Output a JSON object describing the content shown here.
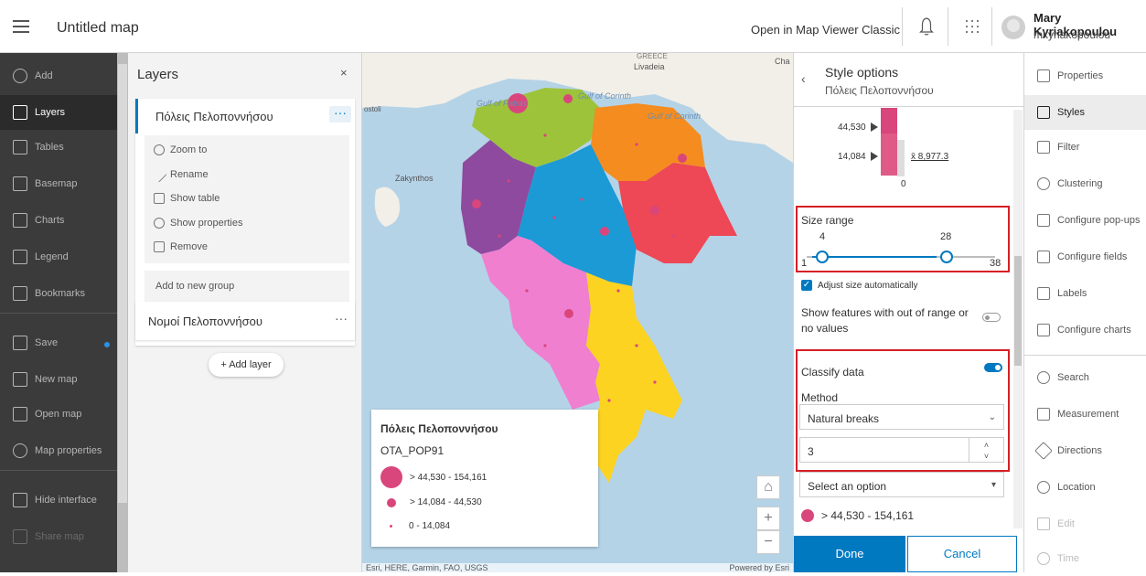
{
  "header": {
    "map_title": "Untitled map",
    "open_classic": "Open in Map Viewer Classic",
    "user_name": "Mary Kyriakopoulou",
    "user_login": "mkyriakopoulou"
  },
  "left_nav": {
    "items": [
      {
        "label": "Add",
        "icon": "plus-circle-icon"
      },
      {
        "label": "Layers",
        "icon": "layers-icon",
        "active": true
      },
      {
        "label": "Tables",
        "icon": "table-icon"
      },
      {
        "label": "Basemap",
        "icon": "basemap-icon"
      },
      {
        "label": "Charts",
        "icon": "chart-icon"
      },
      {
        "label": "Legend",
        "icon": "legend-icon"
      },
      {
        "label": "Bookmarks",
        "icon": "bookmark-icon"
      },
      {
        "label": "Save",
        "icon": "save-icon"
      },
      {
        "label": "New map",
        "icon": "new-map-icon"
      },
      {
        "label": "Open map",
        "icon": "folder-icon"
      },
      {
        "label": "Map properties",
        "icon": "gear-icon"
      },
      {
        "label": "Hide interface",
        "icon": "monitor-icon"
      },
      {
        "label": "Share map",
        "icon": "share-icon",
        "disabled": true
      }
    ]
  },
  "layers_panel": {
    "title": "Layers",
    "close": "×",
    "layer1": {
      "name": "Πόλεις Πελοποννήσου",
      "more": "···",
      "actions": [
        "Zoom to",
        "Rename",
        "Show table",
        "Show properties",
        "Remove"
      ],
      "add_group": "Add to new group"
    },
    "layer2": {
      "name": "Νομοί Πελοποννήσου",
      "more": "···"
    },
    "add_layer": "+  Add layer"
  },
  "map": {
    "labels": {
      "greece": "GREECE",
      "livadeia": "Livadeia",
      "gulf_patras": "Gulf of Patras",
      "gulf_corinth1": "Gulf of Corinth",
      "gulf_corinth2": "Gulf of Corinth",
      "zakynthos": "Zakynthos",
      "ostoli": "ostoli",
      "chalkida": "Cha"
    },
    "legend": {
      "title": "Πόλεις Πελοποννήσου",
      "field": "OTA_POP91",
      "rows": [
        {
          "label": "> 44,530 - 154,161"
        },
        {
          "label": "> 14,084 - 44,530"
        },
        {
          "label": "0 - 14,084"
        }
      ]
    },
    "attribution_left": "Esri, HERE, Garmin, FAO, USGS",
    "attribution_right": "Powered by Esri",
    "colors": {
      "water": "#b5d3e7",
      "land": "#f2efe8",
      "symbol": "#d9467b",
      "regions": [
        "#9dc33b",
        "#f58c1f",
        "#8e4a9e",
        "#1b9ad6",
        "#ee4755",
        "#f07fd0",
        "#fcd320"
      ]
    }
  },
  "style_panel": {
    "title": "Style options",
    "subtitle": "Πόλεις Πελοποννήσου",
    "histogram": {
      "label_top": "44,530",
      "label_mid": "14,084",
      "mean": "x̄ 8,977.3",
      "label_zero": "0"
    },
    "size_range": {
      "label": "Size range",
      "min_value": "4",
      "max_value": "28",
      "range_min": "1",
      "range_max": "38",
      "min_fraction": 0.08,
      "max_fraction": 0.7
    },
    "adjust_auto": "Adjust size automatically",
    "show_out_of_range": "Show features with out of range or no values",
    "classify": {
      "label": "Classify data",
      "on": true
    },
    "method_label": "Method",
    "method_value": "Natural breaks",
    "classes_value": "3",
    "select_placeholder": "Select an option",
    "class_row": "> 44,530 - 154,161",
    "done": "Done",
    "cancel": "Cancel"
  },
  "right_nav": {
    "items": [
      {
        "label": "Properties",
        "icon": "properties-icon"
      },
      {
        "label": "Styles",
        "icon": "styles-icon",
        "active": true
      },
      {
        "label": "Filter",
        "icon": "filter-icon"
      },
      {
        "label": "Clustering",
        "icon": "clustering-icon"
      },
      {
        "label": "Configure pop-ups",
        "icon": "popup-icon"
      },
      {
        "label": "Configure fields",
        "icon": "fields-icon"
      },
      {
        "label": "Labels",
        "icon": "label-icon"
      },
      {
        "label": "Configure charts",
        "icon": "chart-config-icon"
      },
      {
        "label": "Search",
        "icon": "search-icon"
      },
      {
        "label": "Measurement",
        "icon": "measure-icon"
      },
      {
        "label": "Directions",
        "icon": "directions-icon"
      },
      {
        "label": "Location",
        "icon": "location-icon"
      },
      {
        "label": "Edit",
        "icon": "edit-icon",
        "disabled": true
      },
      {
        "label": "Time",
        "icon": "clock-icon",
        "disabled": true
      }
    ]
  }
}
